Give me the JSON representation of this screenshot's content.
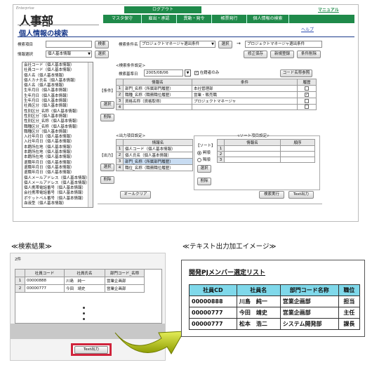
{
  "brand": {
    "sub": "Enterprise",
    "logo": "人事部"
  },
  "menu": {
    "logout": "ログアウト",
    "manual": "マニュアル",
    "items": [
      "マスタ保守",
      "雇出・承認",
      "異動・発令",
      "帳票発行",
      "個人情報の検索"
    ]
  },
  "page": {
    "title": "個人情報の検索",
    "help": "ヘルプ"
  },
  "search": {
    "item_label": "検索項目",
    "item_value": "",
    "search_btn": "検索",
    "cond_label": "検索条件名",
    "cond_value": "プロジェクトマネージャ選出条件",
    "select_btn": "選択",
    "arrow": "→",
    "cond_name_value": "プロジェクトマネージャ選出条件",
    "info_label": "情報選択",
    "info_value": "個人基本情報",
    "select_btn2": "選択",
    "save_btn": "修正保存",
    "new_btn": "新規登録",
    "delete_btn": "条件削除"
  },
  "fieldlist": [
    "会社コード（個人基本情報）",
    "社員コード（個人基本情報）",
    "個人名（個人基本情報）",
    "個人カナ氏名（個人基本情報）",
    "個人名（個人基本情報）",
    "生年月日（個人基本情報）",
    "生年月日（個人基本情報）",
    "生年月日（個人基本情報）",
    "社員区分（個人基本情報）",
    "性別区分_名称（個人基本情報）",
    "性別区分（個人基本情報）",
    "性別区分_名称（個人基本情報）",
    "職種区分_名称（個人基本情報）",
    "職種区分（個人基本情報）",
    "入社年月日（個人基本情報）",
    "入社年月日（個人基本情報）",
    "本籍所在地（個人基本情報）",
    "本籍所在地（個人基本情報）",
    "本籍所在地（個人基本情報）",
    "退職年月日（個人基本情報）",
    "退職年月日（個人基本情報）",
    "退職年月日（個人基本情報）",
    "個人メールアドレス（個人基本情報）",
    "個人メールアドレス（個人基本情報）",
    "個人携帯電話番号（個人基本情報）",
    "会社携帯電話番号（個人基本情報）",
    "ポケットベル番号（個人基本情報）",
    "血液型（個人基本情報）"
  ],
  "cond": {
    "section": "<検索条件設定>",
    "label": "【条件】",
    "date_label": "検索基準日",
    "date_value": "2005/08/06",
    "enrolled_label": "在籍者のみ",
    "code_btn": "コード名称参照",
    "headers": [
      "",
      "情報名",
      "条件",
      "履歴"
    ],
    "rows": [
      {
        "no": "1",
        "name": "部門_名称（所属部門履歴）",
        "cond": "本社管理部",
        "hist": ""
      },
      {
        "no": "2",
        "name": "職種_名称（職務職位履歴）",
        "cond": "営業・販売職",
        "hist": "✓"
      },
      {
        "no": "3",
        "name": "資格名称（資格取得）",
        "cond": "プロジェクトマネージャ",
        "hist": ""
      },
      {
        "no": "4",
        "name": "",
        "cond": "",
        "hist": ""
      }
    ],
    "select_btn": "選択",
    "delete_btn": "削除"
  },
  "output": {
    "section": "<出力項目設定>",
    "label": "【出力】",
    "headers": [
      "",
      "情報名"
    ],
    "rows": [
      {
        "no": "1",
        "name": "個人コード（個人基本情報）"
      },
      {
        "no": "2",
        "name": "個人氏名（個人基本情報）"
      },
      {
        "no": "3",
        "name": "部門_名称（所属部門履歴）"
      },
      {
        "no": "4",
        "name": "職位_名称（職務職位履歴）"
      }
    ],
    "select_btn": "選択",
    "delete_btn": "削除"
  },
  "sort": {
    "section": "<ソート項目設定>",
    "label": "【ソート】",
    "asc": "昇順",
    "desc": "降順",
    "headers": [
      "",
      "情報名",
      "順序"
    ],
    "rows": [
      "1",
      "2",
      "3"
    ],
    "select_btn": "選択",
    "delete_btn": "削除"
  },
  "bottom": {
    "clear_btn": "オールクリア",
    "exec_btn": "検索実行",
    "text_btn": "Text出力"
  },
  "result": {
    "caption": "≪検索結果≫",
    "count": "2件",
    "headers": [
      "",
      "社員コード",
      "社員氏名",
      "部門コード_名称"
    ],
    "rows": [
      {
        "no": "1",
        "code": "00000888",
        "name": "川島　純一",
        "dept": "営業企画部"
      },
      {
        "no": "2",
        "code": "00000777",
        "name": "今田　靖史",
        "dept": "営業企画部"
      }
    ],
    "text_btn": "Text出力"
  },
  "textimg": {
    "caption": "≪テキスト出力加工イメージ≫",
    "title": "開発PJメンバー選定リスト",
    "headers": [
      "社員CD",
      "社員名",
      "部門コード名称",
      "職位"
    ],
    "rows": [
      {
        "code": "00000888",
        "name": "川島　純一",
        "dept": "営業企画部",
        "pos": "担当"
      },
      {
        "code": "00000777",
        "name": "今田　靖史",
        "dept": "営業企画部",
        "pos": "主任"
      },
      {
        "code": "00000777",
        "name": "松本　浩二",
        "dept": "システム開発部",
        "pos": "課長"
      }
    ]
  },
  "colors": {
    "menu_green": "#1f8a4a",
    "title_blue": "#1a3a8a",
    "highlight_red": "#d0243c",
    "arrow_yellow": "#b8c700",
    "header_cyan": "#7fd8ea"
  }
}
